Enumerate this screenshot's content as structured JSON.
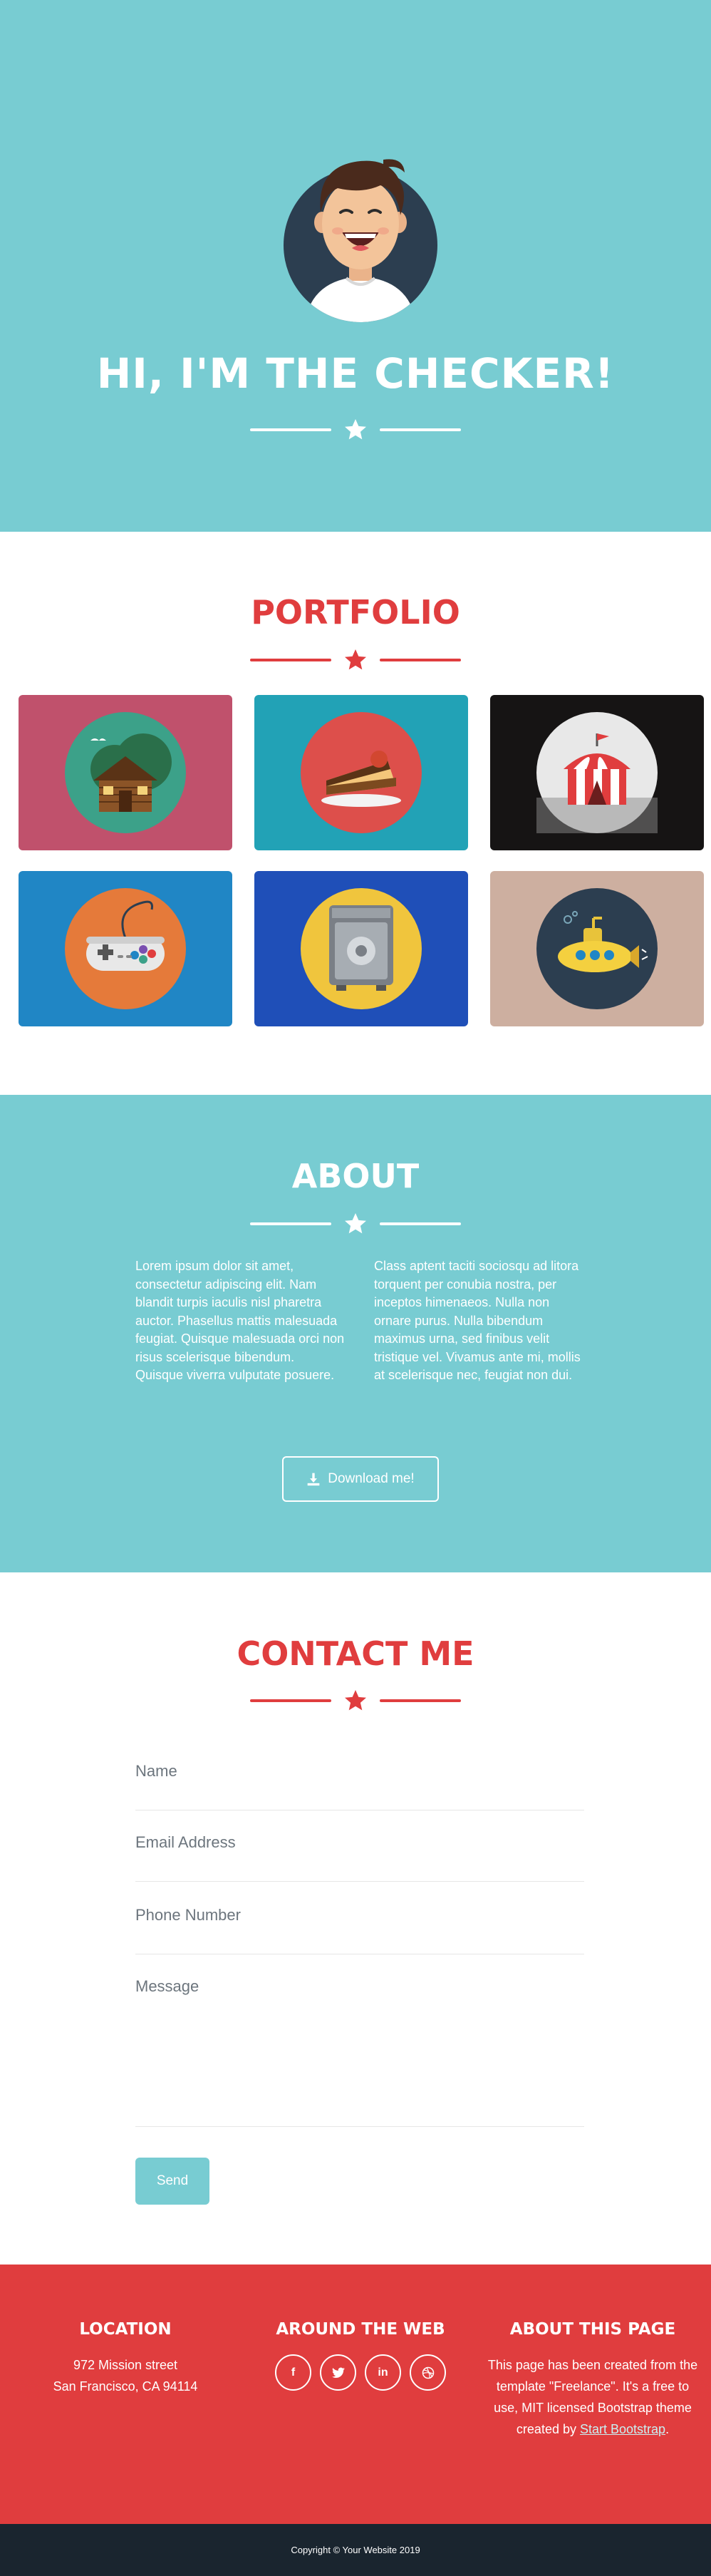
{
  "masthead": {
    "title": "HI, I'M THE CHECKER!"
  },
  "portfolio": {
    "title": "PORTFOLIO",
    "items": [
      {
        "name": "cabin",
        "bg": "#c0516c",
        "circle": "#3ca189"
      },
      {
        "name": "cake",
        "bg": "#22a2b6",
        "circle": "#dd4f4b"
      },
      {
        "name": "circus",
        "bg": "#161414",
        "circle": "#e8e8e8"
      },
      {
        "name": "game",
        "bg": "#2086c5",
        "circle": "#e57a3a"
      },
      {
        "name": "safe",
        "bg": "#1f4fb8",
        "circle": "#f0c53d"
      },
      {
        "name": "submarine",
        "bg": "#cdafa0",
        "circle": "#2c3e50"
      }
    ]
  },
  "about": {
    "title": "ABOUT",
    "left": "Lorem ipsum dolor sit amet, consectetur adipiscing elit. Nam blandit turpis iaculis nisl pharetra auctor. Phasellus mattis malesuada feugiat. Quisque malesuada orci non risus scelerisque bibendum. Quisque viverra vulputate posuere.",
    "right": "Class aptent taciti sociosqu ad litora torquent per conubia nostra, per inceptos himenaeos. Nulla non ornare purus. Nulla bibendum maximus urna, sed finibus velit tristique vel. Vivamus ante mi, mollis at scelerisque nec, feugiat non dui.",
    "button": "Download me!"
  },
  "contact": {
    "title": "CONTACT ME",
    "name_placeholder": "Name",
    "email_placeholder": "Email Address",
    "phone_placeholder": "Phone Number",
    "message_placeholder": "Message",
    "send": "Send"
  },
  "footer": {
    "location": {
      "title": "LOCATION",
      "line1": "972 Mission street",
      "line2": "San Francisco, CA 94114"
    },
    "web": {
      "title": "AROUND THE WEB",
      "icons": [
        "f",
        "t",
        "in",
        "d"
      ]
    },
    "about": {
      "title": "ABOUT THIS PAGE",
      "text": "This page has been created from the template \"Freelance\". It's a free to use, MIT licensed Bootstrap theme created by",
      "link": "Start Bootstrap",
      "end": "."
    }
  },
  "copyright": "Copyright © Your Website 2019",
  "colors": {
    "teal": "#78ccd2",
    "red": "#e03d3e",
    "dark": "#1a252f"
  }
}
